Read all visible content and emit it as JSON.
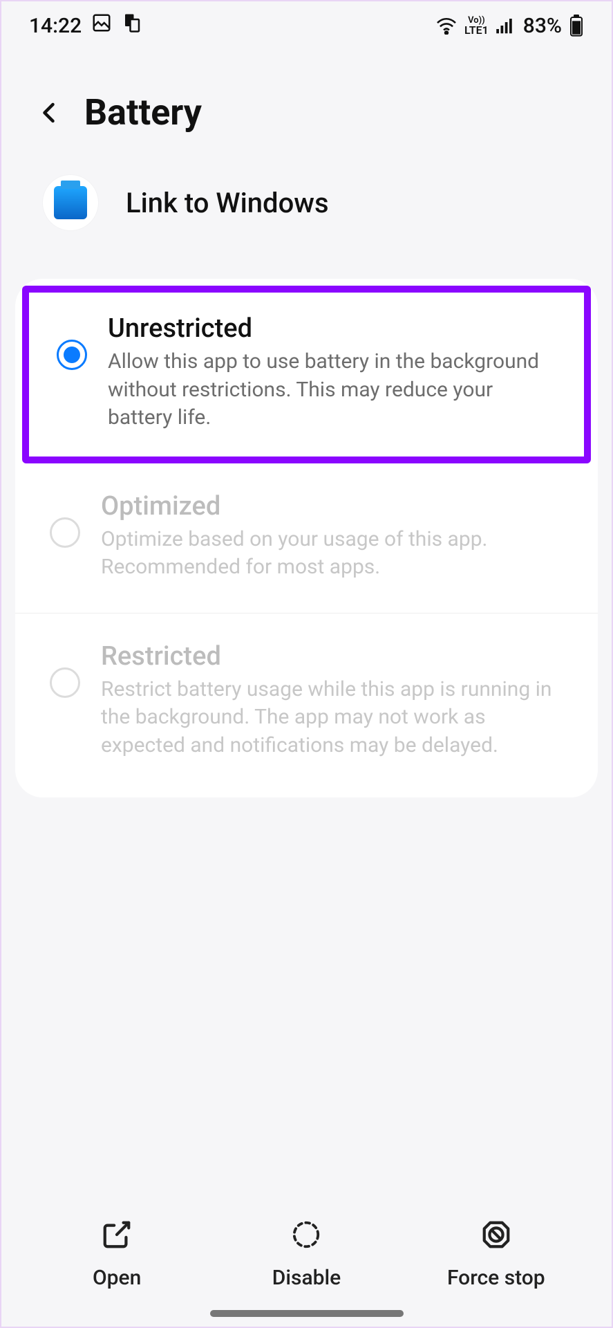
{
  "status": {
    "time": "14:22",
    "battery_percent": "83%",
    "network_label": "LTE1",
    "vo_label": "Vo))"
  },
  "header": {
    "title": "Battery"
  },
  "app": {
    "name": "Link to Windows"
  },
  "options": [
    {
      "title": "Unrestricted",
      "desc": "Allow this app to use battery in the background without restrictions. This may reduce your battery life.",
      "selected": true,
      "highlighted": true,
      "disabled": false
    },
    {
      "title": "Optimized",
      "desc": "Optimize based on your usage of this app. Recommended for most apps.",
      "selected": false,
      "highlighted": false,
      "disabled": true
    },
    {
      "title": "Restricted",
      "desc": "Restrict battery usage while this app is running in the background. The app may not work as expected and notifications may be delayed.",
      "selected": false,
      "highlighted": false,
      "disabled": true
    }
  ],
  "bottom": {
    "open": "Open",
    "disable": "Disable",
    "force_stop": "Force stop"
  }
}
